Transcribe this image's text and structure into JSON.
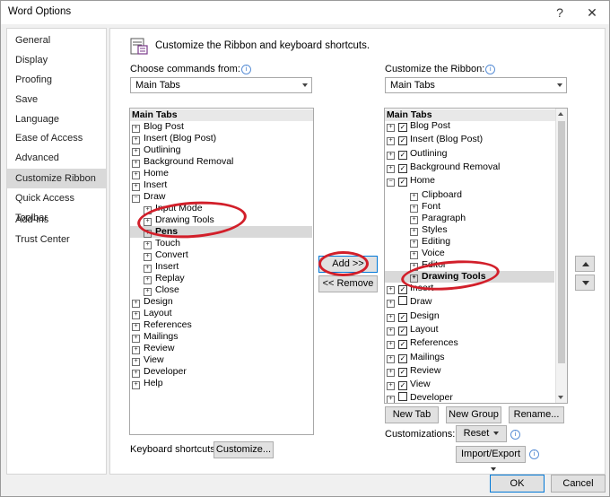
{
  "window": {
    "title": "Word Options",
    "help": "?",
    "close": "✕"
  },
  "nav": {
    "items": [
      {
        "label": "General"
      },
      {
        "label": "Display"
      },
      {
        "label": "Proofing"
      },
      {
        "label": "Save"
      },
      {
        "label": "Language"
      },
      {
        "label": "Ease of Access"
      },
      {
        "label": "Advanced"
      },
      {
        "label": "Customize Ribbon"
      },
      {
        "label": "Quick Access Toolbar"
      },
      {
        "label": "Add-ins"
      },
      {
        "label": "Trust Center"
      }
    ],
    "selected": "Customize Ribbon"
  },
  "header": {
    "text": "Customize the Ribbon and keyboard shortcuts."
  },
  "left": {
    "label": "Choose commands from:",
    "dropdown": "Main Tabs",
    "items": [
      {
        "text": "Main Tabs"
      },
      {
        "text": "Blog Post"
      },
      {
        "text": "Insert (Blog Post)"
      },
      {
        "text": "Outlining"
      },
      {
        "text": "Background Removal"
      },
      {
        "text": "Home"
      },
      {
        "text": "Insert"
      },
      {
        "text": "Draw"
      },
      {
        "text": "Input Mode"
      },
      {
        "text": "Drawing Tools"
      },
      {
        "text": "Pens"
      },
      {
        "text": "Touch"
      },
      {
        "text": "Convert"
      },
      {
        "text": "Insert"
      },
      {
        "text": "Replay"
      },
      {
        "text": "Close"
      },
      {
        "text": "Design"
      },
      {
        "text": "Layout"
      },
      {
        "text": "References"
      },
      {
        "text": "Mailings"
      },
      {
        "text": "Review"
      },
      {
        "text": "View"
      },
      {
        "text": "Developer"
      },
      {
        "text": "Help"
      }
    ]
  },
  "right": {
    "label": "Customize the Ribbon:",
    "dropdown": "Main Tabs",
    "items": [
      {
        "text": "Main Tabs"
      },
      {
        "text": "Blog Post"
      },
      {
        "text": "Insert (Blog Post)"
      },
      {
        "text": "Outlining"
      },
      {
        "text": "Background Removal"
      },
      {
        "text": "Home"
      },
      {
        "text": "Clipboard"
      },
      {
        "text": "Font"
      },
      {
        "text": "Paragraph"
      },
      {
        "text": "Styles"
      },
      {
        "text": "Editing"
      },
      {
        "text": "Voice"
      },
      {
        "text": "Editor"
      },
      {
        "text": "Drawing Tools"
      },
      {
        "text": "Insert"
      },
      {
        "text": "Draw"
      },
      {
        "text": "Design"
      },
      {
        "text": "Layout"
      },
      {
        "text": "References"
      },
      {
        "text": "Mailings"
      },
      {
        "text": "Review"
      },
      {
        "text": "View"
      },
      {
        "text": "Developer"
      }
    ]
  },
  "buttons": {
    "add": "Add >>",
    "remove": "<< Remove",
    "new_tab": "New Tab",
    "new_group": "New Group",
    "rename": "Rename...",
    "reset": "Reset",
    "import_export": "Import/Export",
    "customize": "Customize...",
    "ok": "OK",
    "cancel": "Cancel"
  },
  "labels": {
    "keyboard_shortcuts": "Keyboard shortcuts:",
    "customizations": "Customizations:"
  },
  "colors": {
    "annotation": "#d21f2a",
    "selection": "#d9d9d9",
    "focus": "#0078d7"
  }
}
